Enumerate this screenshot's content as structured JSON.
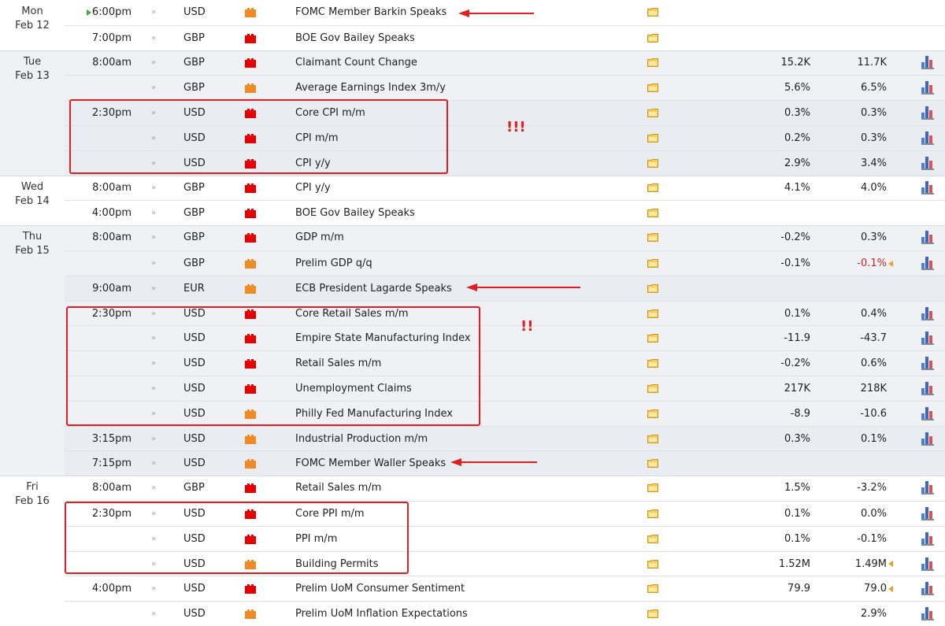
{
  "colors": {
    "impact_high": "#e60000",
    "impact_medium": "#f08a24",
    "annotation": "#e02020",
    "negative": "#c0262b"
  },
  "icons": {
    "sound": "speaker-icon",
    "folder": "folder-icon",
    "chart": "bar-chart-icon",
    "revision": "revision-arrow-icon",
    "active": "play-icon"
  },
  "days": [
    {
      "day": "Mon",
      "date": "Feb 12"
    },
    {
      "day": "Tue",
      "date": "Feb 13"
    },
    {
      "day": "Wed",
      "date": "Feb 14"
    },
    {
      "day": "Thu",
      "date": "Feb 15"
    },
    {
      "day": "Fri",
      "date": "Feb 16"
    }
  ],
  "events": [
    {
      "time": "6:00pm",
      "currency": "USD",
      "impact": "medium",
      "title": "FOMC Member Barkin Speaks",
      "actual": "",
      "forecast": "",
      "chart": false,
      "active": true
    },
    {
      "time": "7:00pm",
      "currency": "GBP",
      "impact": "high",
      "title": "BOE Gov Bailey Speaks",
      "actual": "",
      "forecast": "",
      "chart": false
    },
    {
      "time": "8:00am",
      "currency": "GBP",
      "impact": "high",
      "title": "Claimant Count Change",
      "actual": "15.2K",
      "forecast": "11.7K",
      "chart": true
    },
    {
      "time": "",
      "currency": "GBP",
      "impact": "medium",
      "title": "Average Earnings Index 3m/y",
      "actual": "5.6%",
      "forecast": "6.5%",
      "chart": true
    },
    {
      "time": "2:30pm",
      "currency": "USD",
      "impact": "high",
      "title": "Core CPI m/m",
      "actual": "0.3%",
      "forecast": "0.3%",
      "chart": true
    },
    {
      "time": "",
      "currency": "USD",
      "impact": "high",
      "title": "CPI m/m",
      "actual": "0.2%",
      "forecast": "0.3%",
      "chart": true
    },
    {
      "time": "",
      "currency": "USD",
      "impact": "high",
      "title": "CPI y/y",
      "actual": "2.9%",
      "forecast": "3.4%",
      "chart": true
    },
    {
      "time": "8:00am",
      "currency": "GBP",
      "impact": "high",
      "title": "CPI y/y",
      "actual": "4.1%",
      "forecast": "4.0%",
      "chart": true
    },
    {
      "time": "4:00pm",
      "currency": "GBP",
      "impact": "high",
      "title": "BOE Gov Bailey Speaks",
      "actual": "",
      "forecast": "",
      "chart": false
    },
    {
      "time": "8:00am",
      "currency": "GBP",
      "impact": "high",
      "title": "GDP m/m",
      "actual": "-0.2%",
      "forecast": "0.3%",
      "chart": true
    },
    {
      "time": "",
      "currency": "GBP",
      "impact": "medium",
      "title": "Prelim GDP q/q",
      "actual": "-0.1%",
      "forecast": "-0.1%",
      "forecast_negative": true,
      "revised": true,
      "chart": true
    },
    {
      "time": "9:00am",
      "currency": "EUR",
      "impact": "medium",
      "title": "ECB President Lagarde Speaks",
      "actual": "",
      "forecast": "",
      "chart": false
    },
    {
      "time": "2:30pm",
      "currency": "USD",
      "impact": "high",
      "title": "Core Retail Sales m/m",
      "actual": "0.1%",
      "forecast": "0.4%",
      "chart": true
    },
    {
      "time": "",
      "currency": "USD",
      "impact": "high",
      "title": "Empire State Manufacturing Index",
      "actual": "-11.9",
      "forecast": "-43.7",
      "chart": true
    },
    {
      "time": "",
      "currency": "USD",
      "impact": "high",
      "title": "Retail Sales m/m",
      "actual": "-0.2%",
      "forecast": "0.6%",
      "chart": true
    },
    {
      "time": "",
      "currency": "USD",
      "impact": "high",
      "title": "Unemployment Claims",
      "actual": "217K",
      "forecast": "218K",
      "chart": true
    },
    {
      "time": "",
      "currency": "USD",
      "impact": "medium",
      "title": "Philly Fed Manufacturing Index",
      "actual": "-8.9",
      "forecast": "-10.6",
      "chart": true
    },
    {
      "time": "3:15pm",
      "currency": "USD",
      "impact": "medium",
      "title": "Industrial Production m/m",
      "actual": "0.3%",
      "forecast": "0.1%",
      "chart": true
    },
    {
      "time": "7:15pm",
      "currency": "USD",
      "impact": "medium",
      "title": "FOMC Member Waller Speaks",
      "actual": "",
      "forecast": "",
      "chart": false
    },
    {
      "time": "8:00am",
      "currency": "GBP",
      "impact": "high",
      "title": "Retail Sales m/m",
      "actual": "1.5%",
      "forecast": "-3.2%",
      "chart": true
    },
    {
      "time": "2:30pm",
      "currency": "USD",
      "impact": "high",
      "title": "Core PPI m/m",
      "actual": "0.1%",
      "forecast": "0.0%",
      "chart": true
    },
    {
      "time": "",
      "currency": "USD",
      "impact": "high",
      "title": "PPI m/m",
      "actual": "0.1%",
      "forecast": "-0.1%",
      "chart": true
    },
    {
      "time": "",
      "currency": "USD",
      "impact": "medium",
      "title": "Building Permits",
      "actual": "1.52M",
      "forecast": "1.49M",
      "revised": true,
      "chart": true
    },
    {
      "time": "4:00pm",
      "currency": "USD",
      "impact": "high",
      "title": "Prelim UoM Consumer Sentiment",
      "actual": "79.9",
      "forecast": "79.0",
      "revised": true,
      "chart": true
    },
    {
      "time": "",
      "currency": "USD",
      "impact": "medium",
      "title": "Prelim UoM Inflation Expectations",
      "actual": "",
      "forecast": "2.9%",
      "chart": true
    }
  ],
  "annotations": {
    "marks": [
      "!!!",
      "!!"
    ]
  }
}
